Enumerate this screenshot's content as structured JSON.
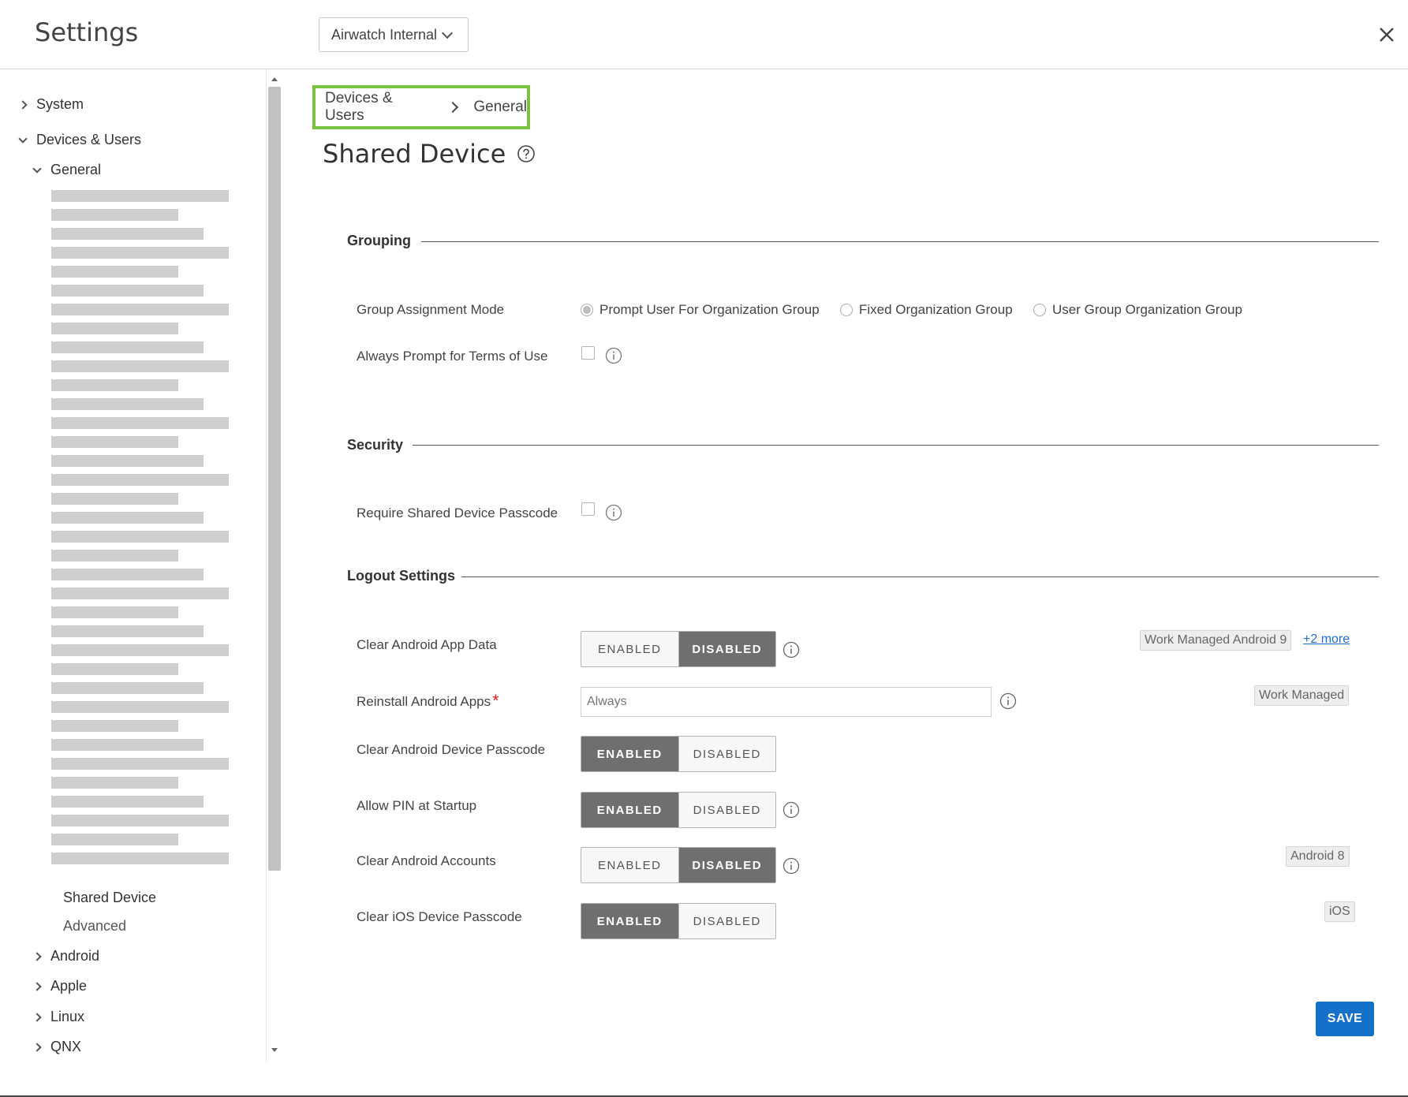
{
  "header": {
    "title": "Settings",
    "org_selector": "Airwatch Internal"
  },
  "sidebar": {
    "system": "System",
    "devices_users": "Devices & Users",
    "general": "General",
    "shared_device": "Shared Device",
    "advanced": "Advanced",
    "android": "Android",
    "apple": "Apple",
    "linux": "Linux",
    "qnx": "QNX"
  },
  "breadcrumb": {
    "parent": "Devices & Users",
    "current": "General"
  },
  "page": {
    "title": "Shared Device"
  },
  "sections": {
    "grouping": "Grouping",
    "security": "Security",
    "logout": "Logout Settings"
  },
  "grouping": {
    "assignment_mode_label": "Group Assignment Mode",
    "options": [
      "Prompt User For Organization Group",
      "Fixed Organization Group",
      "User Group Organization Group"
    ],
    "selected_index": 0,
    "terms_label": "Always Prompt for Terms of Use",
    "terms_checked": false
  },
  "security": {
    "passcode_label": "Require Shared Device Passcode",
    "passcode_checked": false
  },
  "toggle_labels": {
    "enabled": "ENABLED",
    "disabled": "DISABLED"
  },
  "logout": {
    "clear_app_data": {
      "label": "Clear Android App Data",
      "value": "DISABLED"
    },
    "reinstall_apps": {
      "label": "Reinstall Android Apps",
      "required_mark": "*",
      "placeholder": "Always"
    },
    "clear_device_passcode": {
      "label": "Clear Android Device Passcode",
      "value": "ENABLED"
    },
    "allow_pin": {
      "label": "Allow PIN at Startup",
      "value": "ENABLED"
    },
    "clear_accounts": {
      "label": "Clear Android Accounts",
      "value": "DISABLED"
    },
    "clear_ios_passcode": {
      "label": "Clear iOS Device Passcode",
      "value": "ENABLED"
    }
  },
  "tags": {
    "work_managed_android9": "Work Managed Android 9",
    "more": "+2 more",
    "work_managed": "Work Managed",
    "android8": "Android 8",
    "ios": "iOS"
  },
  "actions": {
    "save": "SAVE"
  },
  "colors": {
    "accent": "#1570c9",
    "breadcrumb_highlight": "#7cc242",
    "toggle_on": "#6f6f6f",
    "required": "#d21f1f"
  }
}
